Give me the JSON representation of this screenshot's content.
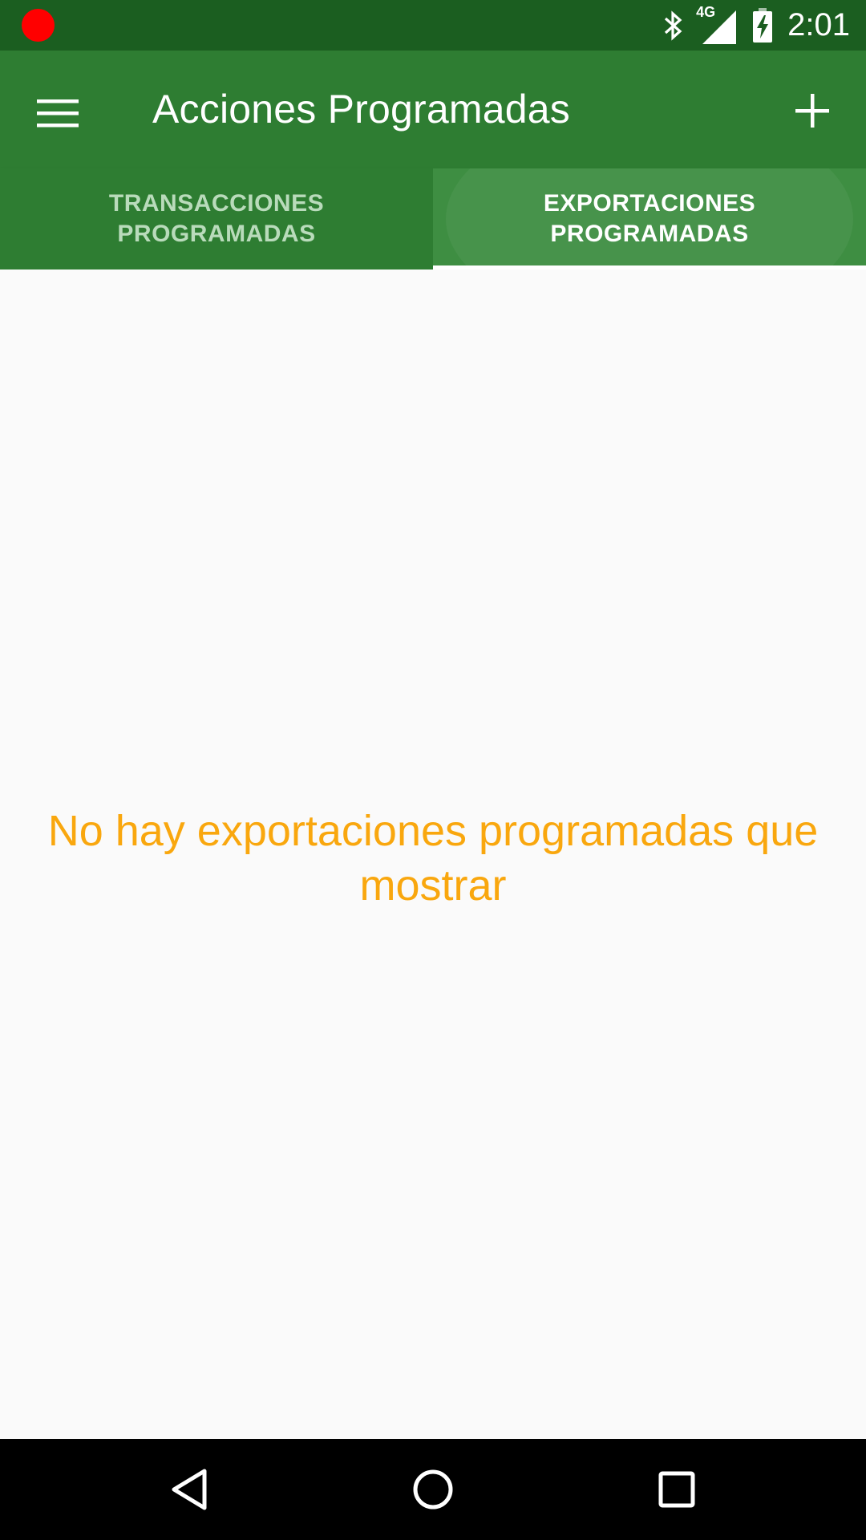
{
  "status_bar": {
    "time": "2:01",
    "network_label": "4G",
    "icons": [
      "recording-dot-icon",
      "bluetooth-icon",
      "signal-4g-icon",
      "battery-charging-icon"
    ]
  },
  "app_bar": {
    "title": "Acciones Programadas",
    "menu_icon": "hamburger-menu-icon",
    "add_icon": "plus-icon"
  },
  "tabs": [
    {
      "label": "TRANSACCIONES\nPROGRAMADAS",
      "selected": false
    },
    {
      "label": "EXPORTACIONES\nPROGRAMADAS",
      "selected": true
    }
  ],
  "main": {
    "empty_message": "No hay exportaciones programadas que mostrar"
  },
  "nav_bar": {
    "icons": [
      "back-triangle-icon",
      "home-circle-icon",
      "recents-square-icon"
    ]
  },
  "colors": {
    "status_bar": "#1B5E20",
    "app_bar": "#2E7D32",
    "empty_message": "#F9A70E",
    "background": "#FAFAFA"
  }
}
